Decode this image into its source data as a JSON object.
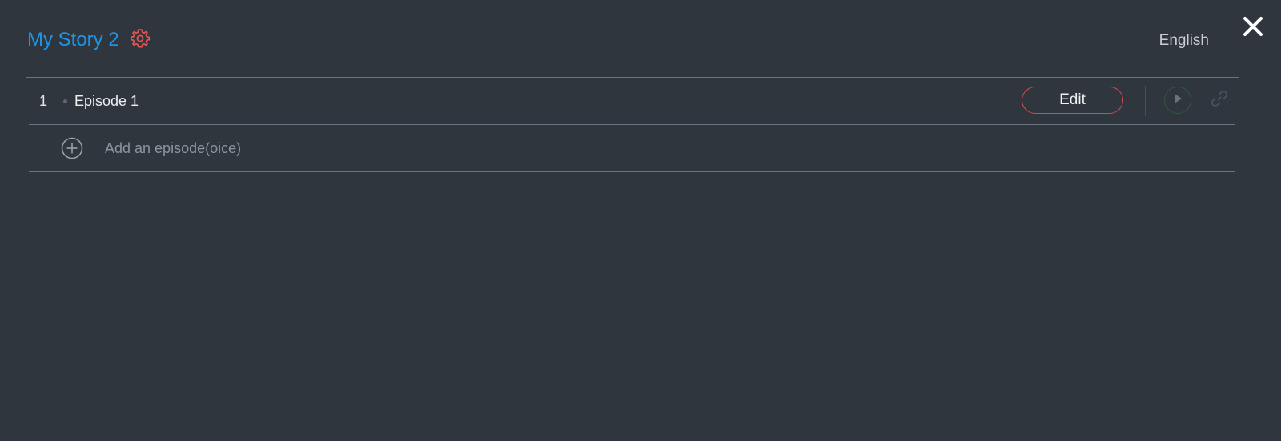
{
  "header": {
    "title": "My Story 2",
    "language": "English"
  },
  "episodes": [
    {
      "index": "1",
      "name": "Episode 1",
      "edit_label": "Edit"
    }
  ],
  "add_episode": {
    "label": "Add an episode(oice)"
  },
  "icons": {
    "settings": "gear-icon",
    "close": "close-icon",
    "play": "play-icon",
    "link": "link-icon",
    "add": "plus-circle-icon"
  },
  "colors": {
    "background": "#2f363e",
    "title": "#1d95e6",
    "accent_red": "#d64b4b",
    "divider": "#6b747d",
    "play_ring": "#2f5a3e"
  }
}
